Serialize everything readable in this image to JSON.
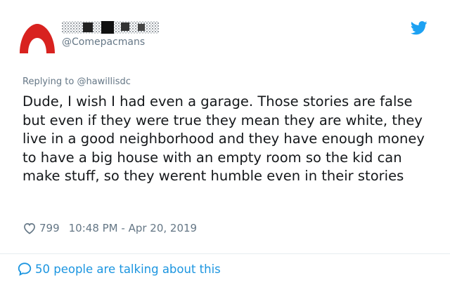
{
  "tweet": {
    "handle": "@Comepacmans",
    "reply_prefix": "Replying to",
    "reply_to": "@hawillisdc",
    "text": "Dude, I wish I had even a garage. Those stories are false but even if they were true they mean they are white, they live in a good neighborhood and they have enough money to have a big house with an empty room so the kid can make stuff, so they werent humble even in their stories",
    "like_count": "799",
    "timestamp": "10:48 PM - Apr 20, 2019",
    "talking_text": "50 people are talking about this"
  },
  "icons": {
    "platform": "twitter-bird-icon",
    "like": "heart-icon",
    "conversation": "speech-bubble-icon"
  },
  "colors": {
    "brand_blue": "#1da1f2",
    "link_blue": "#1b95e0",
    "avatar_red": "#d8221f",
    "muted_text": "#657786",
    "divider": "#e6ecf0"
  }
}
